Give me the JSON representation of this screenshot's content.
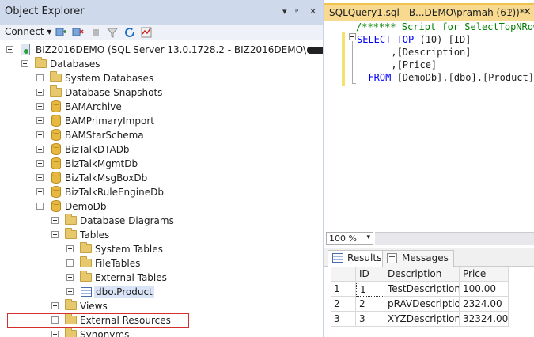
{
  "object_explorer": {
    "title": "Object Explorer",
    "title_buttons": [
      "▾",
      "ᵖ",
      "✕"
    ],
    "toolbar": {
      "connect_label": "Connect ▾"
    },
    "server": {
      "label": "BIZ2016DEMO (SQL Server 13.0.1728.2 - BIZ2016DEMO\\"
    },
    "tree": {
      "databases": "Databases",
      "system_databases": "System Databases",
      "database_snapshots": "Database Snapshots",
      "db_items": [
        "BAMArchive",
        "BAMPrimaryImport",
        "BAMStarSchema",
        "BizTalkDTADb",
        "BizTalkMgmtDb",
        "BizTalkMsgBoxDb",
        "BizTalkRuleEngineDb"
      ],
      "demodb": "DemoDb",
      "database_diagrams": "Database Diagrams",
      "tables": "Tables",
      "system_tables": "System Tables",
      "file_tables": "FileTables",
      "external_tables": "External Tables",
      "product_table": "dbo.Product",
      "views": "Views",
      "external_resources": "External Resources",
      "synonyms": "Synonyms"
    }
  },
  "query_editor": {
    "tab_title": "SQLQuery1.sql - B...DEMO\\pramah (61))*",
    "tab_pin": "ᵖ",
    "tab_close": "✕",
    "code": {
      "line1": "/****** Script for SelectTopNRows",
      "line2_kw": "SELECT TOP",
      "line2_rest": " (10) [ID]",
      "line3": "      ,[Description]",
      "line4": "      ,[Price]",
      "line5_kw": "  FROM",
      "line5_rest": " [DemoDb].[dbo].[Product]"
    },
    "zoom": "100 %",
    "zoom_arrow": "▾"
  },
  "results": {
    "tabs": [
      "Results",
      "Messages"
    ],
    "columns": [
      "ID",
      "Description",
      "Price"
    ],
    "rows": [
      {
        "n": "1",
        "id": "1",
        "description": "TestDescription",
        "price": "100.00"
      },
      {
        "n": "2",
        "id": "2",
        "description": "pRAVDescription",
        "price": "2324.00"
      },
      {
        "n": "3",
        "id": "3",
        "description": "XYZDescription",
        "price": "32324.00"
      }
    ]
  },
  "colors": {
    "accent_tab": "#f7d98f",
    "title_bar": "#cfd9ec",
    "highlight_box": "#d32f2f"
  }
}
